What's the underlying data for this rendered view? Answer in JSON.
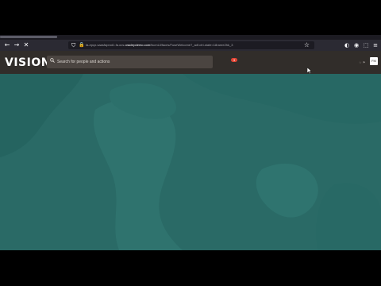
{
  "browser": {
    "url_prefix": "fa-epqx.saasfaprod1.fa.ocs.",
    "url_host": "oraclepdemo.com",
    "url_path": "/fscmUI/faces/FuseWelcome?_adf.ctrl-state=18ranre2hk_3"
  },
  "app": {
    "logo": "VISION",
    "search_placeholder": "Search for people and actions",
    "notification_count": "3",
    "avatar_initials": "FM"
  },
  "icons": {
    "back": "arrow-left-icon",
    "forward": "arrow-right-icon",
    "stop": "close-icon",
    "shield": "shield-icon",
    "lock": "lock-icon",
    "star": "star-icon",
    "search": "search-icon",
    "cursor": "mouse-pointer-icon"
  },
  "colors": {
    "header_bg": "#312d2a",
    "content_bg": "#2a6a66",
    "notification": "#e04535"
  }
}
